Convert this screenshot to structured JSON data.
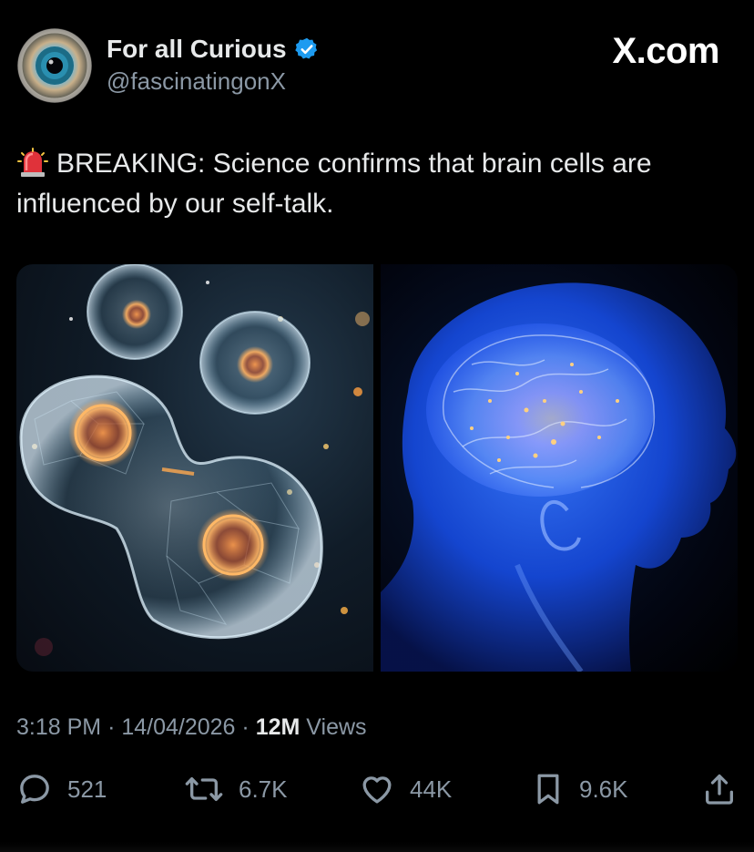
{
  "author": {
    "display_name": "For all Curious",
    "handle": "@fascinatingonX",
    "verified_badge": "verified-check-icon",
    "badge_color": "#1d9bf0"
  },
  "brand": "X.com",
  "post": {
    "emoji_icon": "siren-icon",
    "text": "BREAKING: Science confirms that brain cells are influenced by our self-talk."
  },
  "media": [
    {
      "icon": "cell-division-image"
    },
    {
      "icon": "glowing-brain-head-image"
    }
  ],
  "meta": {
    "time": "3:18 PM",
    "separator": "·",
    "date": "14/04/2026",
    "views_count": "12M",
    "views_label": "Views"
  },
  "actions": {
    "replies": "521",
    "reposts": "6.7K",
    "likes": "44K",
    "bookmarks": "9.6K"
  },
  "colors": {
    "background": "#000000",
    "text_primary": "#e7e9ea",
    "text_secondary": "#8b98a5",
    "accent": "#1d9bf0"
  }
}
